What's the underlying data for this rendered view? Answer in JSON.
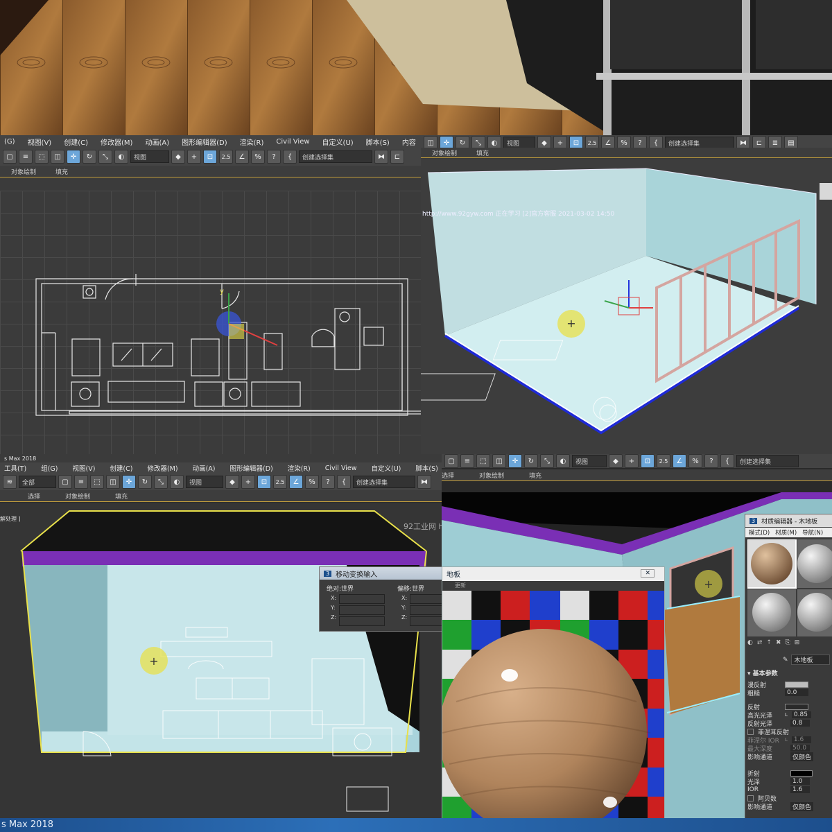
{
  "top_photo": {},
  "menu_top": [
    "(G)",
    "视图(V)",
    "创建(C)",
    "修改器(M)",
    "动画(A)",
    "图形编辑器(D)",
    "渲染(R)",
    "Civil View",
    "自定义(U)",
    "脚本(S)",
    "内容"
  ],
  "menu_bottom": [
    "工具(T)",
    "组(G)",
    "视图(V)",
    "创建(C)",
    "修改器(M)",
    "动画(A)",
    "图形编辑器(D)",
    "渲染(R)",
    "Civil View",
    "自定义(U)",
    "脚本(S)"
  ],
  "toolbar": {
    "view_dropdown": "视图",
    "selection_set": "创建选择集",
    "all_dropdown": "全部",
    "percent_icon": "%",
    "angle_icon": "2.5"
  },
  "ribbon": {
    "object_paint": "对象绘制",
    "fill": "填充",
    "select": "选择"
  },
  "watermark": {
    "url_text": "http://www.92gyw.com 正在学习 [2]官方客服 2021-03-02 14:50",
    "site_short": "92工业网 h",
    "processing": "解处理 ]"
  },
  "transform_dialog": {
    "title": "移动变换输入",
    "absolute_label": "绝对:世界",
    "offset_label": "偏移:世界",
    "axes": [
      "X:",
      "Y:",
      "Z:"
    ]
  },
  "material_editor": {
    "title": "材质编辑器 - 木地板",
    "menus": [
      "模式(D)",
      "材质(M)",
      "导航(N)"
    ],
    "material_name": "木地板",
    "section_title": "基本参数",
    "params": [
      {
        "label": "漫反射",
        "value": ""
      },
      {
        "label": "粗糙",
        "value": "0.0"
      },
      {
        "label": "反射",
        "value": ""
      },
      {
        "label": "高光光泽",
        "value": "0.85",
        "lock": "L"
      },
      {
        "label": "反射光泽",
        "value": "0.8"
      },
      {
        "label": "菲涅耳反射",
        "value": ""
      },
      {
        "label": "菲涅尔 IOR",
        "value": "1.6",
        "lock": "L"
      },
      {
        "label": "最大深度",
        "value": "50.0"
      },
      {
        "label": "影响通道",
        "value": "仅颜色"
      },
      {
        "label": "折射",
        "value": ""
      },
      {
        "label": "光泽",
        "value": "1.0"
      },
      {
        "label": "IOR",
        "value": "1.6"
      },
      {
        "label": "阿贝数",
        "value": ""
      },
      {
        "label": "影响通道",
        "value": "仅颜色"
      }
    ]
  },
  "material_preview": {
    "title": "地板",
    "tab": "更新"
  },
  "taskbar": {
    "app_name": "s Max 2018"
  },
  "colors": {
    "viewport_bg": "#3b3b3b",
    "room_fill": "#bfe0e3",
    "highlight_yellow": "#e8e04a",
    "selection_white": "#ffffff",
    "wall_purple": "#7a2fb5",
    "window_frame": "#d4a5a0"
  }
}
